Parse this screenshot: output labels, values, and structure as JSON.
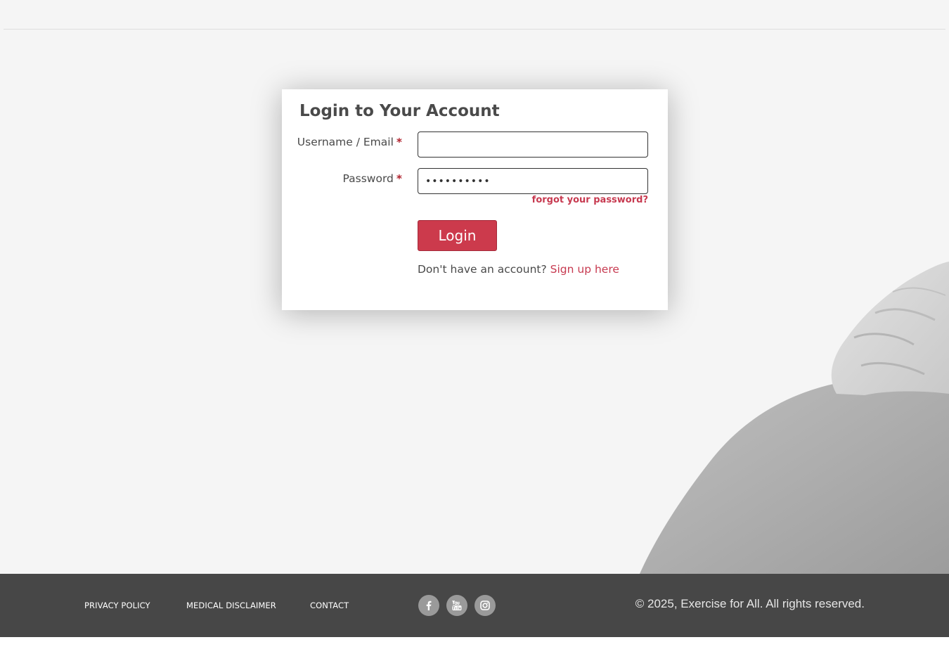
{
  "login": {
    "title": "Login to Your Account",
    "username_label": "Username / Email",
    "password_label": "Password",
    "required_marker": "*",
    "username_value": "",
    "password_value": "••••••••••",
    "forgot_label": "forgot your password?",
    "login_button_label": "Login",
    "signup_prompt": "Don't have an account?",
    "signup_link_label": "Sign up here"
  },
  "footer": {
    "links": [
      "PRIVACY POLICY",
      "MEDICAL DISCLAIMER",
      "CONTACT"
    ],
    "social_icons": [
      "facebook-icon",
      "youtube-icon",
      "instagram-icon"
    ],
    "copyright": "© 2025, Exercise for All. All rights reserved."
  },
  "colors": {
    "accent": "#cc3a4c",
    "link": "#c73a50",
    "required": "#b1242f",
    "footer_bg": "#474747",
    "page_bg": "#f5f5f5"
  }
}
